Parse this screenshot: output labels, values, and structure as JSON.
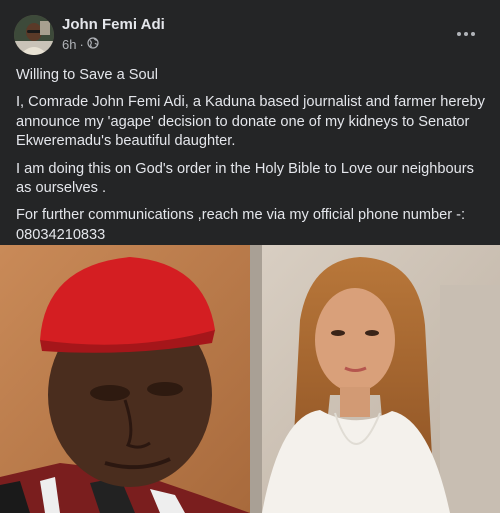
{
  "post": {
    "author": "John Femi Adi",
    "time": "6h",
    "separator": "·",
    "visibility_icon": "globe-icon",
    "more_icon": "more-options-icon",
    "paragraphs": [
      "Willing to Save a Soul",
      "I, Comrade John Femi Adi, a Kaduna based journalist and farmer hereby announce my 'agape' decision to donate one of my kidneys to Senator Ekweremadu's beautiful daughter.",
      "I am doing this on God's order in the  Holy Bible to Love our neighbours as ourselves .",
      "For further communications ,reach me via my official phone number -: 08034210833"
    ],
    "photo": {
      "left_subject": "man-in-red-cap",
      "right_subject": "woman-with-long-hair"
    }
  },
  "colors": {
    "card_bg": "#242526",
    "text_primary": "#e4e6eb",
    "text_secondary": "#b0b3b8"
  }
}
